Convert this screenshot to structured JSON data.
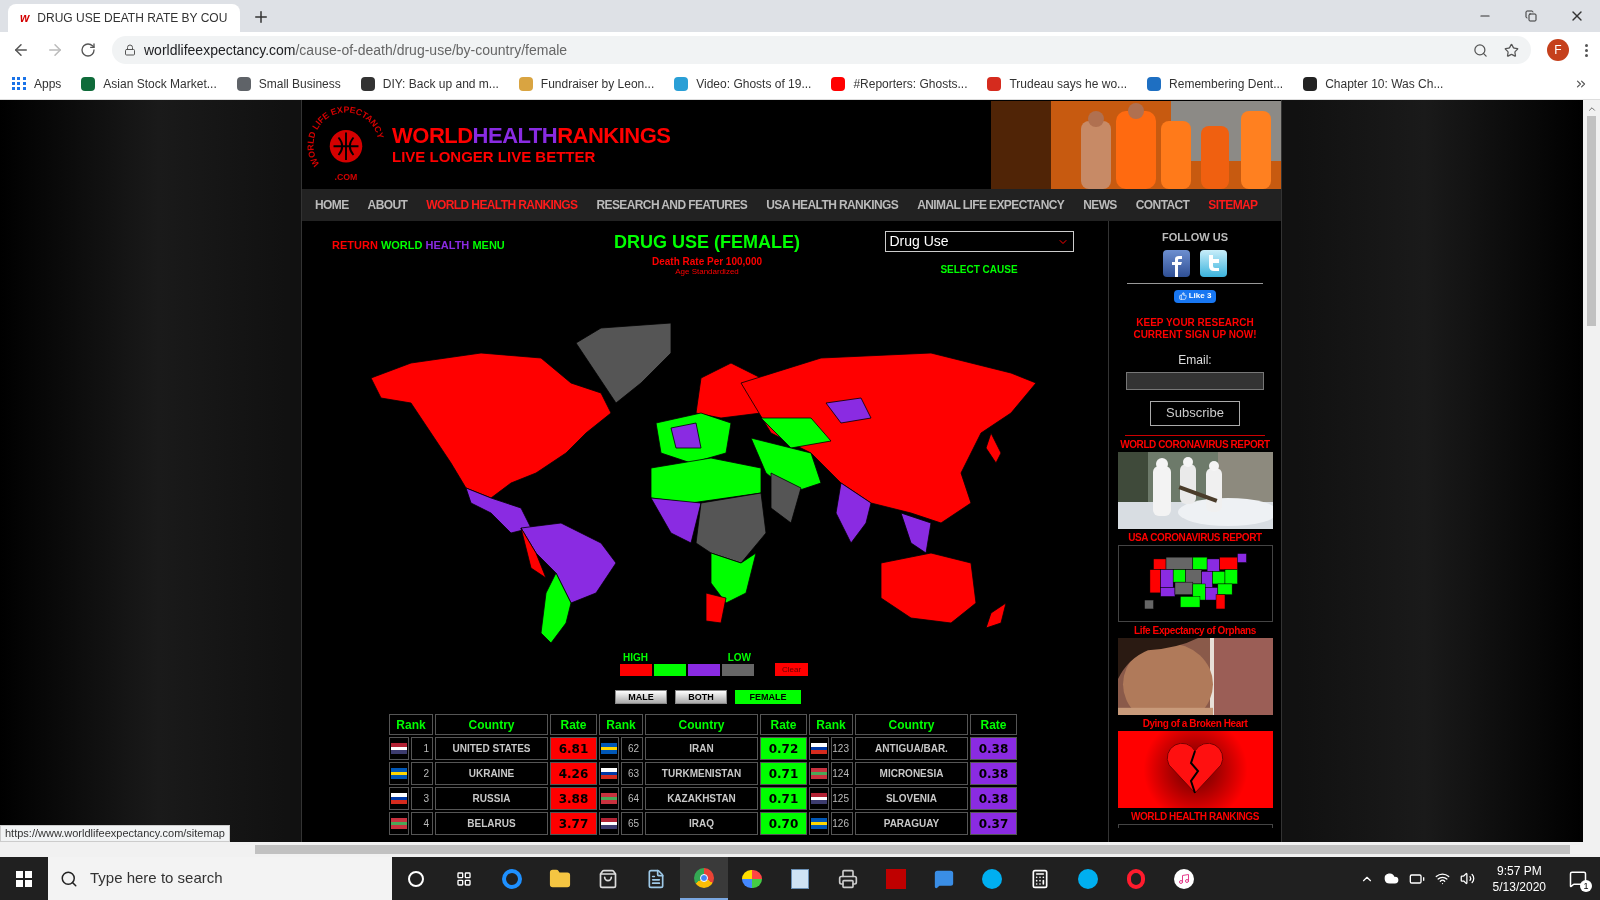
{
  "browser": {
    "tab": {
      "icon": "w",
      "title": "DRUG USE DEATH RATE BY COU"
    },
    "url": {
      "host": "worldlifeexpectancy.com",
      "path": "/cause-of-death/drug-use/by-country/female"
    },
    "profile": "F",
    "bookmarks": [
      {
        "label": "Apps",
        "color": "#1a73e8"
      },
      {
        "label": "Asian Stock Market...",
        "color": "#0f6b3a"
      },
      {
        "label": "Small Business",
        "color": "#5f6368"
      },
      {
        "label": "DIY: Back up and m...",
        "color": "#333333"
      },
      {
        "label": "Fundraiser by Leon...",
        "color": "#d9a441"
      },
      {
        "label": "Video: Ghosts of 19...",
        "color": "#2a9fd6"
      },
      {
        "label": "#Reporters: Ghosts...",
        "color": "#ff0000"
      },
      {
        "label": "Trudeau says he wo...",
        "color": "#d52b1e"
      },
      {
        "label": "Remembering Dent...",
        "color": "#1e6fc2"
      },
      {
        "label": "Chapter 10: Was Ch...",
        "color": "#222222"
      }
    ]
  },
  "site": {
    "logo": {
      "ring": "WORLD LIFE EXPECTANCY",
      "bottom": ".COM"
    },
    "title_parts": [
      {
        "text": "WORLD",
        "color": "#ff0000"
      },
      {
        "text": "HEALTH",
        "color": "#8a2be2"
      },
      {
        "text": "RANKINGS",
        "color": "#ff0000"
      }
    ],
    "tagline": "LIVE LONGER LIVE BETTER"
  },
  "nav": [
    {
      "label": "HOME",
      "highlighted": false
    },
    {
      "label": "ABOUT",
      "highlighted": false
    },
    {
      "label": "WORLD HEALTH RANKINGS",
      "highlighted": true
    },
    {
      "label": "RESEARCH AND FEATURES",
      "highlighted": false
    },
    {
      "label": "USA HEALTH RANKINGS",
      "highlighted": false
    },
    {
      "label": "ANIMAL LIFE EXPECTANCY",
      "highlighted": false
    },
    {
      "label": "NEWS",
      "highlighted": false
    },
    {
      "label": "CONTACT",
      "highlighted": false
    },
    {
      "label": "SITEMAP",
      "highlighted": true
    }
  ],
  "return_link": [
    {
      "text": "RETURN",
      "color": "#ff0000"
    },
    {
      "text": "WORLD",
      "color": "#00ff00"
    },
    {
      "text": "HEALTH",
      "color": "#8a2be2"
    },
    {
      "text": "MENU",
      "color": "#00ff00"
    }
  ],
  "heading": {
    "title": "DRUG USE (FEMALE)",
    "subtitle": "Death Rate Per 100,000",
    "note": "Age Standardized"
  },
  "cause_select": {
    "value": "Drug Use",
    "label": "SELECT CAUSE"
  },
  "legend": {
    "high": "HIGH",
    "low": "LOW",
    "swatches": [
      {
        "color": "#ff0000"
      },
      {
        "color": "#00ff00"
      },
      {
        "color": "#8a2be2"
      },
      {
        "color": "#666666"
      }
    ],
    "clear": "Clear"
  },
  "sex_buttons": [
    {
      "label": "MALE",
      "selected": false
    },
    {
      "label": "BOTH",
      "selected": false
    },
    {
      "label": "FEMALE",
      "selected": true
    }
  ],
  "table": {
    "columns": [
      "Rank",
      "Country",
      "Rate",
      "Rank",
      "Country",
      "Rate",
      "Rank",
      "Country",
      "Rate"
    ],
    "rows": [
      {
        "entries": [
          {
            "rank": "1",
            "country": "UNITED STATES",
            "rate": "6.81",
            "color": "#ff0000"
          },
          {
            "rank": "62",
            "country": "IRAN",
            "rate": "0.72",
            "color": "#00ff00"
          },
          {
            "rank": "123",
            "country": "ANTIGUA/BAR.",
            "rate": "0.38",
            "color": "#8a2be2"
          }
        ]
      },
      {
        "entries": [
          {
            "rank": "2",
            "country": "UKRAINE",
            "rate": "4.26",
            "color": "#ff0000"
          },
          {
            "rank": "63",
            "country": "TURKMENISTAN",
            "rate": "0.71",
            "color": "#00ff00"
          },
          {
            "rank": "124",
            "country": "MICRONESIA",
            "rate": "0.38",
            "color": "#8a2be2"
          }
        ]
      },
      {
        "entries": [
          {
            "rank": "3",
            "country": "RUSSIA",
            "rate": "3.88",
            "color": "#ff0000"
          },
          {
            "rank": "64",
            "country": "KAZAKHSTAN",
            "rate": "0.71",
            "color": "#00ff00"
          },
          {
            "rank": "125",
            "country": "SLOVENIA",
            "rate": "0.38",
            "color": "#8a2be2"
          }
        ]
      },
      {
        "entries": [
          {
            "rank": "4",
            "country": "BELARUS",
            "rate": "3.77",
            "color": "#ff0000"
          },
          {
            "rank": "65",
            "country": "IRAQ",
            "rate": "0.70",
            "color": "#00ff00"
          },
          {
            "rank": "126",
            "country": "PARAGUAY",
            "rate": "0.37",
            "color": "#8a2be2"
          }
        ]
      }
    ]
  },
  "sidebar": {
    "follow": "FOLLOW US",
    "like": "Like 3",
    "signup": "KEEP YOUR RESEARCH CURRENT SIGN UP NOW!",
    "email_label": "Email:",
    "subscribe": "Subscribe",
    "features": [
      {
        "title": "WORLD CORONAVIRUS REPORT",
        "kind": "picture"
      },
      {
        "title": "USA CORONAVIRUS REPORT",
        "kind": "us_map"
      },
      {
        "title": "Life Expectancy of Orphans",
        "kind": "picture"
      },
      {
        "title": "Dying of a Broken Heart",
        "kind": "heart"
      },
      {
        "title": "WORLD HEALTH RANKINGS",
        "kind": "cut"
      }
    ]
  },
  "status_url": "https://www.worldlifeexpectancy.com/sitemap",
  "taskbar": {
    "search": "Type here to search",
    "time": "9:57 PM",
    "date": "5/13/2020",
    "notifications": "1"
  }
}
